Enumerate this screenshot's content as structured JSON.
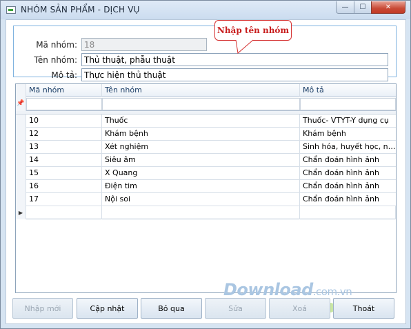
{
  "window": {
    "title": "NHÓM SẢN PHẨM - DỊCH VỤ",
    "min_glyph": "—",
    "max_glyph": "☐",
    "close_glyph": "✕"
  },
  "form": {
    "code_label": "Mã nhóm:",
    "code_value": "18",
    "name_label": "Tên nhóm:",
    "name_value": "Thủ thuật, phẫu thuật",
    "desc_label": "Mô tả:",
    "desc_value": "Thực hiện thủ thuật"
  },
  "callout": {
    "text": "Nhập tên nhóm",
    "color": "#c81e1e"
  },
  "grid": {
    "columns": [
      "Mã nhóm",
      "Tên nhóm",
      "Mô tả"
    ],
    "filter_icon": "📌",
    "rows": [
      [
        "10",
        "Thuốc",
        "Thuốc- VTYT-Y dụng cụ"
      ],
      [
        "12",
        "Khám bệnh",
        "Khám bệnh"
      ],
      [
        "13",
        "Xét nghiệm",
        "Sinh hóa, huyết học, nước tiểu"
      ],
      [
        "14",
        "Siêu âm",
        "Chẩn đoán hình ảnh"
      ],
      [
        "15",
        "X Quang",
        "Chẩn đoán hình ảnh"
      ],
      [
        "16",
        "Điện tim",
        "Chẩn đoán hình ảnh"
      ],
      [
        "17",
        "Nội soi",
        "Chẩn đoán hình ảnh"
      ]
    ],
    "new_row_icon": "▶"
  },
  "watermark": {
    "brand": "Download",
    "suffix": ".com.vn"
  },
  "dots": [
    "#f7c4c4",
    "#d8d8d8",
    "#c9e6a4",
    "#f7e3a3",
    "#b8daf4",
    "#f5b7b7"
  ],
  "buttons": {
    "new": "Nhập mới",
    "update": "Cập nhật",
    "skip": "Bỏ qua",
    "edit": "Sửa",
    "delete": "Xoá",
    "exit": "Thoát"
  }
}
